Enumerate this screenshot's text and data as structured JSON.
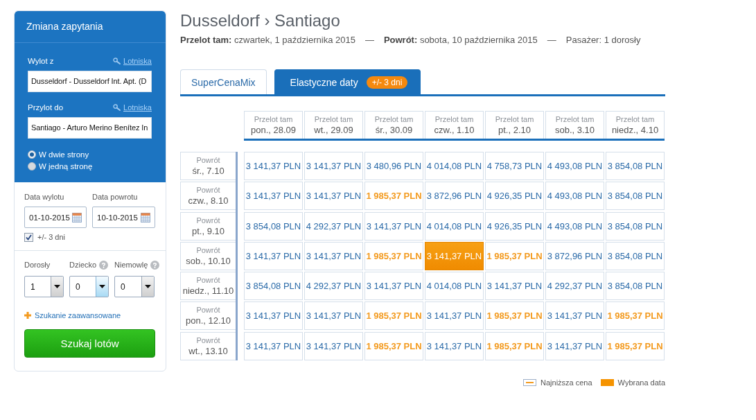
{
  "sidebar": {
    "title": "Zmiana zapytania",
    "locations": [
      {
        "label": "Wylot z",
        "link": "Lotniska",
        "value": "Dusseldorf - Dusseldorf Int. Apt. (D"
      },
      {
        "label": "Przylot do",
        "link": "Lotniska",
        "value": "Santiago - Arturo Merino Benítez In"
      }
    ],
    "trip_type": [
      {
        "label": "W dwie strony",
        "selected": true
      },
      {
        "label": "W jedną stronę",
        "selected": false
      }
    ],
    "dates": [
      {
        "label": "Data wylotu",
        "value": "01-10-2015"
      },
      {
        "label": "Data powrotu",
        "value": "10-10-2015"
      }
    ],
    "flex_dates": {
      "label": "+/- 3 dni",
      "checked": true
    },
    "passengers": [
      {
        "label": "Dorosły",
        "value": "1",
        "help": false,
        "highlighted": false
      },
      {
        "label": "Dziecko",
        "value": "0",
        "help": true,
        "highlighted": true
      },
      {
        "label": "Niemowlę",
        "value": "0",
        "help": true,
        "highlighted": false
      }
    ],
    "advanced_link": "Szukanie zaawansowane",
    "search_button": "Szukaj lotów"
  },
  "header": {
    "title": "Dusseldorf › Santiago",
    "summary": [
      {
        "kind": "text",
        "text": "**Przelot tam:** czwartek, 1 października 2015"
      },
      {
        "kind": "separator",
        "text": "—"
      },
      {
        "kind": "text",
        "text": "**Powrót:** sobota, 10 października 2015"
      },
      {
        "kind": "separator",
        "text": "—"
      },
      {
        "kind": "text",
        "text": "Pasażer: 1 dorosły"
      }
    ]
  },
  "tabs": [
    {
      "label": "SuperCenaMix",
      "selected": false
    },
    {
      "label": "Elastyczne daty",
      "badge": "+/- 3 dni",
      "selected": true
    }
  ],
  "grid": {
    "columns": [
      {
        "label": "Przelot tam",
        "date": "pon., 28.09"
      },
      {
        "label": "Przelot tam",
        "date": "wt., 29.09"
      },
      {
        "label": "Przelot tam",
        "date": "śr., 30.09"
      },
      {
        "label": "Przelot tam",
        "date": "czw., 1.10"
      },
      {
        "label": "Przelot tam",
        "date": "pt., 2.10"
      },
      {
        "label": "Przelot tam",
        "date": "sob., 3.10"
      },
      {
        "label": "Przelot tam",
        "date": "niedz., 4.10"
      }
    ],
    "rows": [
      {
        "label": "Powrót",
        "date": "śr., 7.10",
        "cells": [
          {
            "price": "3 141,37 PLN",
            "lowest": false,
            "selected": false
          },
          {
            "price": "3 141,37 PLN",
            "lowest": false,
            "selected": false
          },
          {
            "price": "3 480,96 PLN",
            "lowest": false,
            "selected": false
          },
          {
            "price": "4 014,08 PLN",
            "lowest": false,
            "selected": false
          },
          {
            "price": "4 758,73 PLN",
            "lowest": false,
            "selected": false
          },
          {
            "price": "4 493,08 PLN",
            "lowest": false,
            "selected": false
          },
          {
            "price": "3 854,08 PLN",
            "lowest": false,
            "selected": false
          }
        ]
      },
      {
        "label": "Powrót",
        "date": "czw., 8.10",
        "cells": [
          {
            "price": "3 141,37 PLN",
            "lowest": false,
            "selected": false
          },
          {
            "price": "3 141,37 PLN",
            "lowest": false,
            "selected": false
          },
          {
            "price": "1 985,37 PLN",
            "lowest": true,
            "selected": false
          },
          {
            "price": "3 872,96 PLN",
            "lowest": false,
            "selected": false
          },
          {
            "price": "4 926,35 PLN",
            "lowest": false,
            "selected": false
          },
          {
            "price": "4 493,08 PLN",
            "lowest": false,
            "selected": false
          },
          {
            "price": "3 854,08 PLN",
            "lowest": false,
            "selected": false
          }
        ]
      },
      {
        "label": "Powrót",
        "date": "pt., 9.10",
        "cells": [
          {
            "price": "3 854,08 PLN",
            "lowest": false,
            "selected": false
          },
          {
            "price": "4 292,37 PLN",
            "lowest": false,
            "selected": false
          },
          {
            "price": "3 141,37 PLN",
            "lowest": false,
            "selected": false
          },
          {
            "price": "4 014,08 PLN",
            "lowest": false,
            "selected": false
          },
          {
            "price": "4 926,35 PLN",
            "lowest": false,
            "selected": false
          },
          {
            "price": "4 493,08 PLN",
            "lowest": false,
            "selected": false
          },
          {
            "price": "3 854,08 PLN",
            "lowest": false,
            "selected": false
          }
        ]
      },
      {
        "label": "Powrót",
        "date": "sob., 10.10",
        "cells": [
          {
            "price": "3 141,37 PLN",
            "lowest": false,
            "selected": false
          },
          {
            "price": "3 141,37 PLN",
            "lowest": false,
            "selected": false
          },
          {
            "price": "1 985,37 PLN",
            "lowest": true,
            "selected": false
          },
          {
            "price": "3 141,37 PLN",
            "lowest": false,
            "selected": true
          },
          {
            "price": "1 985,37 PLN",
            "lowest": true,
            "selected": false
          },
          {
            "price": "3 872,96 PLN",
            "lowest": false,
            "selected": false
          },
          {
            "price": "3 854,08 PLN",
            "lowest": false,
            "selected": false
          }
        ]
      },
      {
        "label": "Powrót",
        "date": "niedz., 11.10",
        "cells": [
          {
            "price": "3 854,08 PLN",
            "lowest": false,
            "selected": false
          },
          {
            "price": "4 292,37 PLN",
            "lowest": false,
            "selected": false
          },
          {
            "price": "3 141,37 PLN",
            "lowest": false,
            "selected": false
          },
          {
            "price": "4 014,08 PLN",
            "lowest": false,
            "selected": false
          },
          {
            "price": "3 141,37 PLN",
            "lowest": false,
            "selected": false
          },
          {
            "price": "4 292,37 PLN",
            "lowest": false,
            "selected": false
          },
          {
            "price": "3 854,08 PLN",
            "lowest": false,
            "selected": false
          }
        ]
      },
      {
        "label": "Powrót",
        "date": "pon., 12.10",
        "cells": [
          {
            "price": "3 141,37 PLN",
            "lowest": false,
            "selected": false
          },
          {
            "price": "3 141,37 PLN",
            "lowest": false,
            "selected": false
          },
          {
            "price": "1 985,37 PLN",
            "lowest": true,
            "selected": false
          },
          {
            "price": "3 141,37 PLN",
            "lowest": false,
            "selected": false
          },
          {
            "price": "1 985,37 PLN",
            "lowest": true,
            "selected": false
          },
          {
            "price": "3 141,37 PLN",
            "lowest": false,
            "selected": false
          },
          {
            "price": "1 985,37 PLN",
            "lowest": true,
            "selected": false
          }
        ]
      },
      {
        "label": "Powrót",
        "date": "wt., 13.10",
        "cells": [
          {
            "price": "3 141,37 PLN",
            "lowest": false,
            "selected": false
          },
          {
            "price": "3 141,37 PLN",
            "lowest": false,
            "selected": false
          },
          {
            "price": "1 985,37 PLN",
            "lowest": true,
            "selected": false
          },
          {
            "price": "3 141,37 PLN",
            "lowest": false,
            "selected": false
          },
          {
            "price": "1 985,37 PLN",
            "lowest": true,
            "selected": false
          },
          {
            "price": "3 141,37 PLN",
            "lowest": false,
            "selected": false
          },
          {
            "price": "1 985,37 PLN",
            "lowest": true,
            "selected": false
          }
        ]
      }
    ]
  },
  "legend": [
    {
      "kind": "lowest",
      "label": "Najniższa cena"
    },
    {
      "kind": "selected",
      "label": "Wybrana data"
    }
  ]
}
